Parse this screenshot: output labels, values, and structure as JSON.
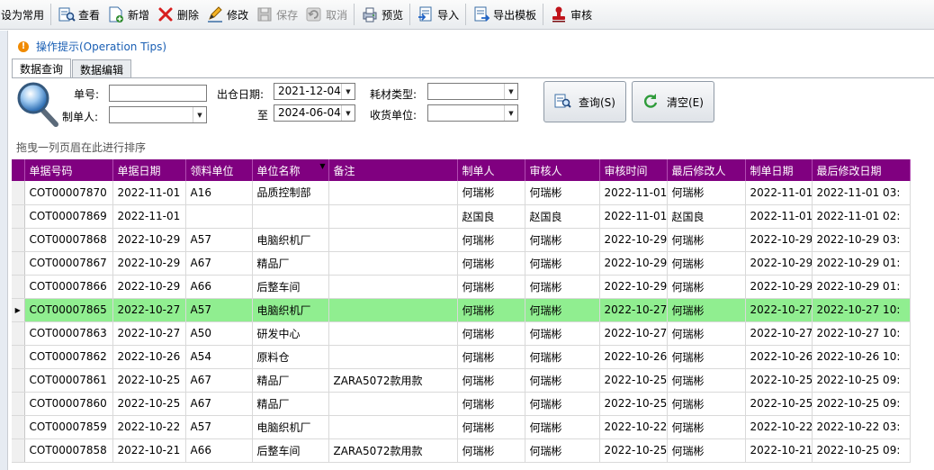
{
  "toolbar": {
    "items": [
      {
        "label": "设为常用",
        "icon": "pin-icon",
        "disabled": false
      },
      {
        "label": "查看",
        "icon": "view-icon",
        "disabled": false
      },
      {
        "label": "新增",
        "icon": "add-icon",
        "disabled": false
      },
      {
        "label": "删除",
        "icon": "delete-icon",
        "disabled": false
      },
      {
        "label": "修改",
        "icon": "edit-icon",
        "disabled": false
      },
      {
        "label": "保存",
        "icon": "save-icon",
        "disabled": true
      },
      {
        "label": "取消",
        "icon": "undo-icon",
        "disabled": true
      },
      {
        "label": "预览",
        "icon": "preview-icon",
        "disabled": false
      },
      {
        "label": "导入",
        "icon": "import-icon",
        "disabled": false
      },
      {
        "label": "导出模板",
        "icon": "export-icon",
        "disabled": false
      },
      {
        "label": "审核",
        "icon": "stamp-icon",
        "disabled": false
      }
    ]
  },
  "tips": {
    "label": "操作提示(Operation Tips)"
  },
  "tabs": [
    {
      "label": "数据查询",
      "active": true
    },
    {
      "label": "数据编辑",
      "active": false
    }
  ],
  "query": {
    "bill_no_label": "单号:",
    "bill_no_value": "",
    "creator_label": "制单人:",
    "creator_value": "",
    "out_date_label": "出仓日期:",
    "date_from": "2021-12-04",
    "to_label": "至",
    "date_to": "2024-06-04",
    "material_type_label": "耗材类型:",
    "material_type_value": "",
    "receiver_label": "收货单位:",
    "receiver_value": "",
    "search_button": "查询(S)",
    "clear_button": "清空(E)"
  },
  "group_hint": "拖曳一列页眉在此进行排序",
  "grid": {
    "columns": [
      "单据号码",
      "单据日期",
      "领料单位",
      "单位名称",
      "备注",
      "制单人",
      "审核人",
      "审核时间",
      "最后修改人",
      "制单日期",
      "最后修改日期"
    ],
    "sorted_column": 3,
    "selected_row": 5,
    "rows": [
      [
        "COT00007870",
        "2022-11-01",
        "A16",
        "品质控制部",
        "",
        "何瑞彬",
        "何瑞彬",
        "2022-11-01",
        "何瑞彬",
        "2022-11-01",
        "2022-11-01 03:"
      ],
      [
        "COT00007869",
        "2022-11-01",
        "",
        "",
        "",
        "赵国良",
        "赵国良",
        "2022-11-01",
        "赵国良",
        "2022-11-01",
        "2022-11-01 02:"
      ],
      [
        "COT00007868",
        "2022-10-29",
        "A57",
        "电脑织机厂",
        "",
        "何瑞彬",
        "何瑞彬",
        "2022-10-29",
        "何瑞彬",
        "2022-10-29",
        "2022-10-29 03:"
      ],
      [
        "COT00007867",
        "2022-10-29",
        "A67",
        "精品厂",
        "",
        "何瑞彬",
        "何瑞彬",
        "2022-10-29",
        "何瑞彬",
        "2022-10-29",
        "2022-10-29 01:"
      ],
      [
        "COT00007866",
        "2022-10-29",
        "A66",
        "后整车间",
        "",
        "何瑞彬",
        "何瑞彬",
        "2022-10-29",
        "何瑞彬",
        "2022-10-29",
        "2022-10-29 01:"
      ],
      [
        "COT00007865",
        "2022-10-27",
        "A57",
        "电脑织机厂",
        "",
        "何瑞彬",
        "何瑞彬",
        "2022-10-27",
        "何瑞彬",
        "2022-10-27",
        "2022-10-27 10:"
      ],
      [
        "COT00007863",
        "2022-10-27",
        "A50",
        "研发中心",
        "",
        "何瑞彬",
        "何瑞彬",
        "2022-10-27",
        "何瑞彬",
        "2022-10-27",
        "2022-10-27 10:"
      ],
      [
        "COT00007862",
        "2022-10-26",
        "A54",
        "原料仓",
        "",
        "何瑞彬",
        "何瑞彬",
        "2022-10-26",
        "何瑞彬",
        "2022-10-26",
        "2022-10-26 10:"
      ],
      [
        "COT00007861",
        "2022-10-25",
        "A67",
        "精品厂",
        "ZARA5072款用款",
        "何瑞彬",
        "何瑞彬",
        "2022-10-25",
        "何瑞彬",
        "2022-10-25",
        "2022-10-25 09:"
      ],
      [
        "COT00007860",
        "2022-10-25",
        "A67",
        "精品厂",
        "",
        "何瑞彬",
        "何瑞彬",
        "2022-10-25",
        "何瑞彬",
        "2022-10-25",
        "2022-10-25 09:"
      ],
      [
        "COT00007859",
        "2022-10-22",
        "A57",
        "电脑织机厂",
        "",
        "何瑞彬",
        "何瑞彬",
        "2022-10-22",
        "何瑞彬",
        "2022-10-22",
        "2022-10-22 03:"
      ],
      [
        "COT00007858",
        "2022-10-21",
        "A66",
        "后整车间",
        "ZARA5072款用款",
        "何瑞彬",
        "何瑞彬",
        "2022-10-25",
        "何瑞彬",
        "2022-10-21",
        "2022-10-25 09:"
      ]
    ]
  },
  "colors": {
    "header_bg": "#800080",
    "selected_row": "#90ee90",
    "tips_text": "#1a5fb4"
  }
}
